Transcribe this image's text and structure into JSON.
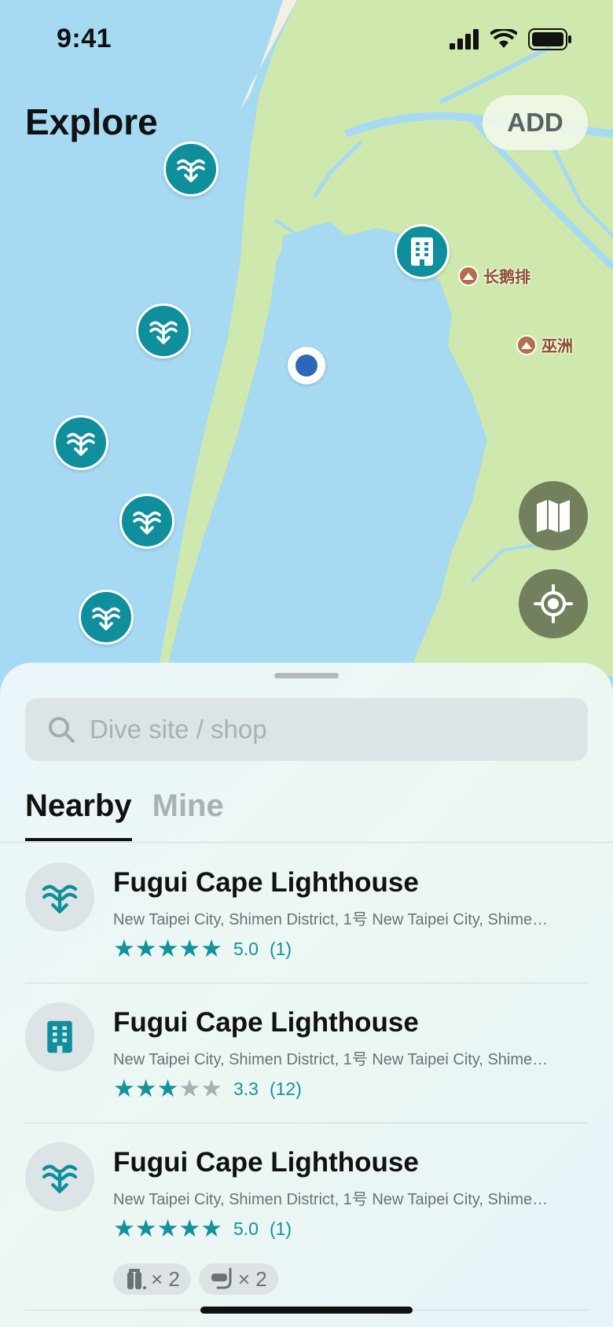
{
  "status": {
    "time": "9:41"
  },
  "header": {
    "title": "Explore",
    "add_label": "ADD"
  },
  "map": {
    "places": [
      {
        "name": "长鹅排"
      },
      {
        "name": "巫洲"
      }
    ],
    "colors": {
      "water": "#a6daf2",
      "land": "#cfe8ad",
      "marker": "#0f8f9c",
      "fab": "#72805d"
    }
  },
  "search": {
    "placeholder": "Dive site / shop"
  },
  "tabs": [
    {
      "label": "Nearby",
      "active": true
    },
    {
      "label": "Mine",
      "active": false
    }
  ],
  "items": [
    {
      "icon": "dive-site-icon",
      "name": "Fugui Cape Lighthouse",
      "address": "New Taipei City, Shimen District, 1号 New Taipei City, Shimen...",
      "rating": 5.0,
      "rating_text": "5.0",
      "count_text": "(1)"
    },
    {
      "icon": "dive-shop-icon",
      "name": "Fugui Cape Lighthouse",
      "address": "New Taipei City, Shimen District, 1号 New Taipei City, Shimen...",
      "rating": 3.3,
      "rating_text": "3.3",
      "count_text": "(12)"
    },
    {
      "icon": "dive-site-icon",
      "name": "Fugui Cape Lighthouse",
      "address": "New Taipei City, Shimen District, 1号 New Taipei City, Shimen...",
      "rating": 5.0,
      "rating_text": "5.0",
      "count_text": "(1)",
      "tags": [
        {
          "icon": "scuba-tank-icon",
          "text": "× 2"
        },
        {
          "icon": "snorkel-mask-icon",
          "text": "× 2"
        }
      ]
    }
  ]
}
